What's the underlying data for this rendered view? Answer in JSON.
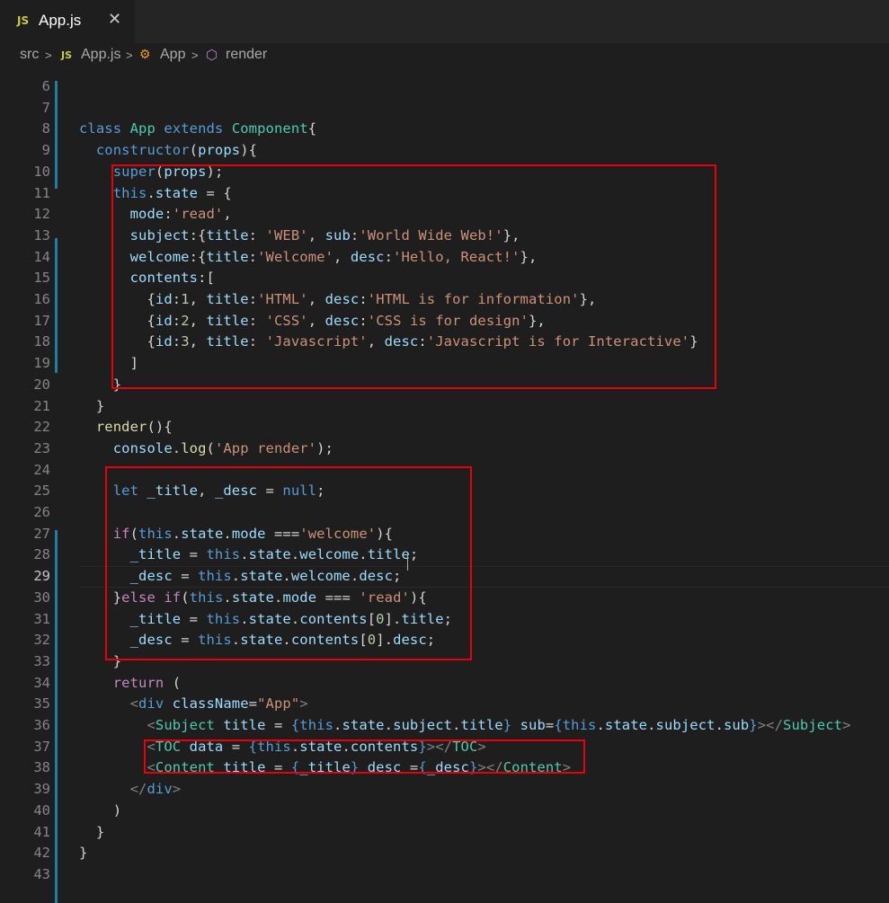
{
  "tab": {
    "lang_badge": "JS",
    "title": "App.js",
    "close_glyph": "✕"
  },
  "breadcrumb": {
    "items": [
      "src",
      "App.js",
      "App",
      "render"
    ],
    "separator": ">"
  },
  "lines": [
    {
      "n": "6",
      "html": ""
    },
    {
      "n": "7",
      "html": ""
    },
    {
      "n": "8",
      "html": "<span class='k'>class</span> <span class='t'>App</span> <span class='k'>extends</span> <span class='t'>Component</span>{"
    },
    {
      "n": "9",
      "html": "  <span class='k'>constructor</span>(<span class='v'>props</span>){"
    },
    {
      "n": "10",
      "html": "    <span class='k'>super</span>(<span class='v'>props</span>);"
    },
    {
      "n": "11",
      "html": "    <span class='k'>this</span>.<span class='v'>state</span> = {"
    },
    {
      "n": "12",
      "html": "      <span class='v'>mode</span>:<span class='s'>'read'</span>,"
    },
    {
      "n": "13",
      "html": "      <span class='v'>subject</span>:{<span class='v'>title</span>: <span class='s'>'WEB'</span>, <span class='v'>sub</span>:<span class='s'>'World Wide Web!'</span>},"
    },
    {
      "n": "14",
      "html": "      <span class='v'>welcome</span>:{<span class='v'>title</span>:<span class='s'>'Welcome'</span>, <span class='v'>desc</span>:<span class='s'>'Hello, React!'</span>},"
    },
    {
      "n": "15",
      "html": "      <span class='v'>contents</span>:["
    },
    {
      "n": "16",
      "html": "        {<span class='v'>id</span>:<span class='n'>1</span>, <span class='v'>title</span>:<span class='s'>'HTML'</span>, <span class='v'>desc</span>:<span class='s'>'HTML is for information'</span>},"
    },
    {
      "n": "17",
      "html": "        {<span class='v'>id</span>:<span class='n'>2</span>, <span class='v'>title</span>: <span class='s'>'CSS'</span>, <span class='v'>desc</span>:<span class='s'>'CSS is for design'</span>},"
    },
    {
      "n": "18",
      "html": "        {<span class='v'>id</span>:<span class='n'>3</span>, <span class='v'>title</span>: <span class='s'>'Javascript'</span>, <span class='v'>desc</span>:<span class='s'>'Javascript is for Interactive'</span>}"
    },
    {
      "n": "19",
      "html": "      ]"
    },
    {
      "n": "20",
      "html": "    }"
    },
    {
      "n": "21",
      "html": "  }"
    },
    {
      "n": "22",
      "html": "  <span class='f'>render</span>(){"
    },
    {
      "n": "23",
      "html": "    <span class='v'>console</span>.<span class='f'>log</span>(<span class='s'>'App render'</span>);"
    },
    {
      "n": "24",
      "html": ""
    },
    {
      "n": "25",
      "html": "    <span class='k'>let</span> <span class='v'>_title</span>, <span class='v'>_desc</span> = <span class='k'>null</span>;"
    },
    {
      "n": "26",
      "html": ""
    },
    {
      "n": "27",
      "html": "    <span class='c'>if</span>(<span class='k'>this</span>.<span class='v'>state</span>.<span class='v'>mode</span> ===<span class='s'>'welcome'</span>){"
    },
    {
      "n": "28",
      "html": "      <span class='v'>_title</span> = <span class='k'>this</span>.<span class='v'>state</span>.<span class='v'>welcome</span>.<span class='v'>title</span>;"
    },
    {
      "n": "29",
      "html": "      <span class='v'>_desc</span> = <span class='k'>this</span>.<span class='v'>state</span>.<span class='v'>welcome</span>.<span class='v'>desc</span>;"
    },
    {
      "n": "30",
      "html": "    }<span class='c'>else</span> <span class='c'>if</span>(<span class='k'>this</span>.<span class='v'>state</span>.<span class='v'>mode</span> === <span class='s'>'read'</span>){"
    },
    {
      "n": "31",
      "html": "      <span class='v'>_title</span> = <span class='k'>this</span>.<span class='v'>state</span>.<span class='v'>contents</span>[<span class='n'>0</span>].<span class='v'>title</span>;"
    },
    {
      "n": "32",
      "html": "      <span class='v'>_desc</span> = <span class='k'>this</span>.<span class='v'>state</span>.<span class='v'>contents</span>[<span class='n'>0</span>].<span class='v'>desc</span>;"
    },
    {
      "n": "33",
      "html": "    }"
    },
    {
      "n": "34",
      "html": "    <span class='c'>return</span> ("
    },
    {
      "n": "35",
      "html": "      <span class='g'>&lt;</span><span class='k'>div</span> <span class='v'>className</span>=<span class='s'>\"App\"</span><span class='g'>&gt;</span>"
    },
    {
      "n": "36",
      "html": "        <span class='g'>&lt;</span><span class='t'>Subject</span> <span class='v'>title</span> = <span class='k'>{</span><span class='k'>this</span>.<span class='v'>state</span>.<span class='v'>subject</span>.<span class='v'>title</span><span class='k'>}</span> <span class='v'>sub</span>=<span class='k'>{</span><span class='k'>this</span>.<span class='v'>state</span>.<span class='v'>subject</span>.<span class='v'>sub</span><span class='k'>}</span><span class='g'>&gt;&lt;/</span><span class='t'>Subject</span><span class='g'>&gt;</span>"
    },
    {
      "n": "37",
      "html": "        <span class='g'>&lt;</span><span class='t'>TOC</span> <span class='v'>data</span> = <span class='k'>{</span><span class='k'>this</span>.<span class='v'>state</span>.<span class='v'>contents</span><span class='k'>}</span><span class='g'>&gt;&lt;/</span><span class='t'>TOC</span><span class='g'>&gt;</span>"
    },
    {
      "n": "38",
      "html": "        <span class='g'>&lt;</span><span class='t'>Content</span> <span class='v'>title</span> = <span class='k'>{</span><span class='v'>_title</span><span class='k'>}</span> <span class='v'>desc</span> =<span class='k'>{</span><span class='v'>_desc</span><span class='k'>}</span><span class='g'>&gt;&lt;/</span><span class='t'>Content</span><span class='g'>&gt;</span>"
    },
    {
      "n": "39",
      "html": "      <span class='g'>&lt;/</span><span class='k'>div</span><span class='g'>&gt;</span>"
    },
    {
      "n": "40",
      "html": "    )"
    },
    {
      "n": "41",
      "html": "  }"
    },
    {
      "n": "42",
      "html": "}"
    },
    {
      "n": "43",
      "html": ""
    }
  ],
  "active_line": "29",
  "colors": {
    "keyword": "#569cd6",
    "control": "#c586c0",
    "type": "#4ec9b0",
    "function": "#dcdcaa",
    "string": "#ce9178",
    "variable": "#9cdcfe",
    "highlight_box": "#e8000a"
  }
}
